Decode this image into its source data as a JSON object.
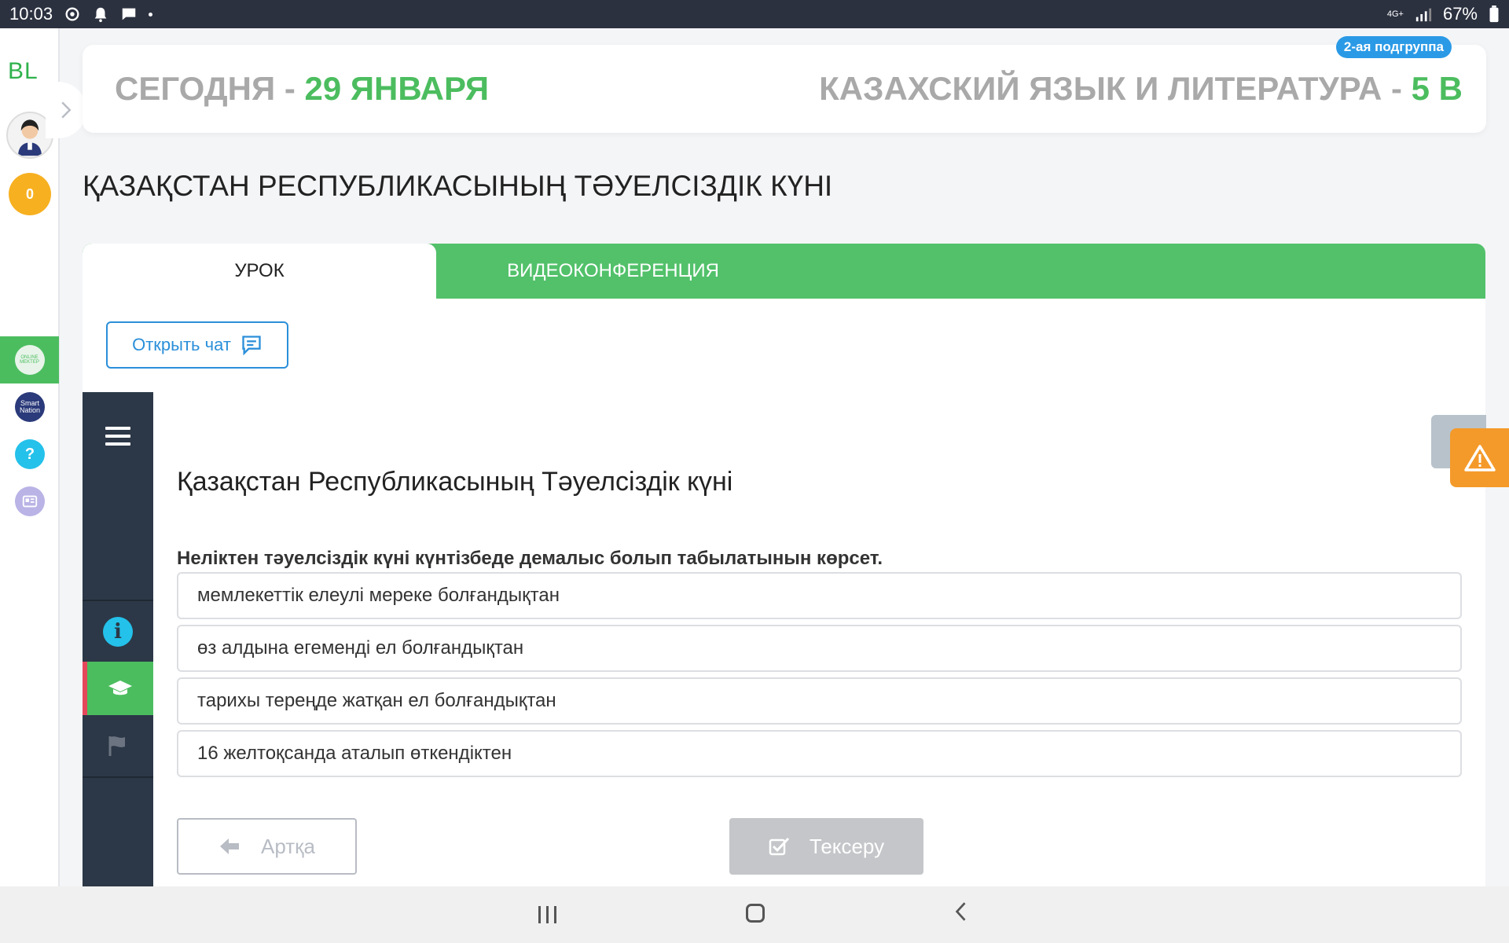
{
  "status_bar": {
    "time": "10:03",
    "network": "4G+",
    "battery": "67%"
  },
  "rail": {
    "logo": "BL",
    "coins": "0",
    "online_label": "ONLINE MEKTEP",
    "smart_label": "Smart Nation",
    "help_label": "?"
  },
  "header": {
    "today_prefix": "СЕГОДНЯ - ",
    "today_date": "29 ЯНВАРЯ",
    "subject_prefix": "КАЗАХСКИЙ ЯЗЫК И ЛИТЕРАТУРА - ",
    "class_name": "5 В",
    "subgroup_badge": "2-ая подгруппа"
  },
  "lesson_title": "ҚАЗАҚСТАН РЕСПУБЛИКАСЫНЫҢ ТӘУЕЛСІЗДІК КҮНІ",
  "tabs": [
    {
      "label": "УРОК"
    },
    {
      "label": "ВИДЕОКОНФЕРЕНЦИЯ"
    }
  ],
  "chat_button": {
    "label": "Открыть чат"
  },
  "module": {
    "heading": "Қазақстан Республикасының Тәуелсіздік күні",
    "question": "Неліктен тәуелсіздік күні күнтізбеде демалыс болып табылатынын көрсет.",
    "options": [
      {
        "label": "мемлекеттік елеулі мереке болғандықтан"
      },
      {
        "label": "өз алдына егеменді ел болғандықтан"
      },
      {
        "label": "тарихы тереңде жатқан ел болғандықтан"
      },
      {
        "label": "16 желтоқсанда аталып өткендіктен"
      }
    ],
    "back_label": "Артқа",
    "check_label": "Тексеру"
  },
  "colors": {
    "accent": "#4cbd5f",
    "dark_sidebar": "#2c3847",
    "warning": "#f49a2a",
    "link": "#2b8fd9"
  }
}
